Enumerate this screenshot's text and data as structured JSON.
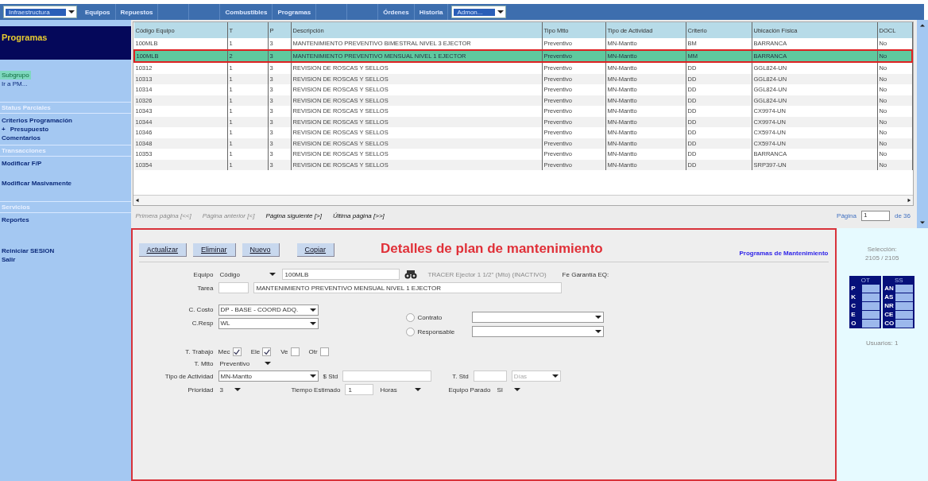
{
  "menu": [
    {
      "kind": "select",
      "label": "Infraestructura"
    },
    {
      "kind": "link",
      "label": "Equipos"
    },
    {
      "kind": "link",
      "label": "Repuestos"
    },
    {
      "kind": "gap"
    },
    {
      "kind": "gap"
    },
    {
      "kind": "link",
      "label": "Combustibles"
    },
    {
      "kind": "link",
      "label": "Programas"
    },
    {
      "kind": "gap"
    },
    {
      "kind": "gap"
    },
    {
      "kind": "link",
      "label": "Órdenes"
    },
    {
      "kind": "link",
      "label": "Historia"
    },
    {
      "kind": "select",
      "label": "Admon..."
    }
  ],
  "sidebar": [
    {
      "kind": "title",
      "label": "Programas"
    },
    {
      "kind": "space"
    },
    {
      "kind": "item",
      "label": "Subgrupo",
      "selected": true
    },
    {
      "kind": "item",
      "label": "Ir a PM...",
      "selected": false
    },
    {
      "kind": "space"
    },
    {
      "kind": "header",
      "label": "Status Parciales"
    },
    {
      "kind": "bold",
      "label": "Criterios Programación",
      "selected": false
    },
    {
      "kind": "tree",
      "label": "Presupuesto",
      "sign": "+",
      "selected": false
    },
    {
      "kind": "bold",
      "label": "Comentarios",
      "selected": false
    },
    {
      "kind": "header",
      "label": "Transacciones"
    },
    {
      "kind": "bold",
      "label": "Modificar F/P",
      "selected": false
    },
    {
      "kind": "space"
    },
    {
      "kind": "bold",
      "label": "Modificar Masivamente",
      "selected": false
    },
    {
      "kind": "space"
    },
    {
      "kind": "header",
      "label": "Servicios"
    },
    {
      "kind": "bold",
      "label": "Reportes",
      "selected": false
    },
    {
      "kind": "space"
    },
    {
      "kind": "space"
    },
    {
      "kind": "bold",
      "label": "Reiniciar SESION",
      "selected": false
    },
    {
      "kind": "bold",
      "label": "Salir",
      "selected": false
    }
  ],
  "table": {
    "columns": [
      "Código Equipo",
      "T",
      "P",
      "Descripción",
      "Tipo Mtto",
      "Tipo de Actividad",
      "Criterio",
      "Ubicación Física",
      "DOCL"
    ],
    "rows": [
      {
        "selected": false,
        "cells": [
          "100MLB",
          "1",
          "3",
          "MANTENIMIENTO PREVENTIVO BIMESTRAL NIVEL 3 EJECTOR",
          "Preventivo",
          "MN-Mantto",
          "BM",
          "BARRANCA",
          "No"
        ]
      },
      {
        "selected": true,
        "cells": [
          "100MLB",
          "2",
          "3",
          "MANTENIMIENTO PREVENTIVO MENSUAL NIVEL 1 EJECTOR",
          "Preventivo",
          "MN-Mantto",
          "MM",
          "BARRANCA",
          "No"
        ]
      },
      {
        "selected": false,
        "cells": [
          "10312",
          "1",
          "3",
          "REVISION DE ROSCAS Y SELLOS",
          "Preventivo",
          "MN-Mantto",
          "DD",
          "GGL824-UN",
          "No"
        ]
      },
      {
        "selected": false,
        "cells": [
          "10313",
          "1",
          "3",
          "REVISION DE ROSCAS Y SELLOS",
          "Preventivo",
          "MN-Mantto",
          "DD",
          "GGL824-UN",
          "No"
        ]
      },
      {
        "selected": false,
        "cells": [
          "10314",
          "1",
          "3",
          "REVISION DE ROSCAS Y SELLOS",
          "Preventivo",
          "MN-Mantto",
          "DD",
          "GGL824-UN",
          "No"
        ]
      },
      {
        "selected": false,
        "cells": [
          "10326",
          "1",
          "3",
          "REVISION DE ROSCAS Y SELLOS",
          "Preventivo",
          "MN-Mantto",
          "DD",
          "GGL824-UN",
          "No"
        ]
      },
      {
        "selected": false,
        "cells": [
          "10343",
          "1",
          "3",
          "REVISION DE ROSCAS Y SELLOS",
          "Preventivo",
          "MN-Mantto",
          "DD",
          "CX9974-UN",
          "No"
        ]
      },
      {
        "selected": false,
        "cells": [
          "10344",
          "1",
          "3",
          "REVISION DE ROSCAS Y SELLOS",
          "Preventivo",
          "MN-Mantto",
          "DD",
          "CX9974-UN",
          "No"
        ]
      },
      {
        "selected": false,
        "cells": [
          "10346",
          "1",
          "3",
          "REVISION DE ROSCAS Y SELLOS",
          "Preventivo",
          "MN-Mantto",
          "DD",
          "CX5974-UN",
          "No"
        ]
      },
      {
        "selected": false,
        "cells": [
          "10348",
          "1",
          "3",
          "REVISION DE ROSCAS Y SELLOS",
          "Preventivo",
          "MN-Mantto",
          "DD",
          "CX5974-UN",
          "No"
        ]
      },
      {
        "selected": false,
        "cells": [
          "10353",
          "1",
          "3",
          "REVISION DE ROSCAS Y SELLOS",
          "Preventivo",
          "MN-Mantto",
          "DD",
          "BARRANCA",
          "No"
        ]
      },
      {
        "selected": false,
        "cells": [
          "10354",
          "1",
          "3",
          "REVISION DE ROSCAS Y SELLOS",
          "Preventivo",
          "MN-Mantto",
          "DD",
          "SRP397-UN",
          "No"
        ]
      }
    ]
  },
  "pager": {
    "links": [
      {
        "label": "Primera página [<<]",
        "disabled": true
      },
      {
        "label": "Página anterior [<]",
        "disabled": true
      },
      {
        "label": "Página siguiente [>]",
        "disabled": false
      },
      {
        "label": "Última página [>>]",
        "disabled": false
      }
    ],
    "page_label": "Página",
    "page": "1",
    "total": "de 36"
  },
  "details": {
    "title": "Detalles de plan de mantenimiento",
    "link": "Programas de Mantenimiento",
    "buttons": [
      "Actualizar",
      "Eliminar",
      "Nuevo",
      "Copiar"
    ],
    "equipo": {
      "label": "Equipo",
      "mode": "Código",
      "value": "100MLB",
      "info": "TRACER Ejector 1 1/2\" (Mto) (INACTIVO)",
      "warranty": "Fe Garantía EQ:"
    },
    "tarea": {
      "label": "Tarea",
      "value": "MANTENIMIENTO PREVENTIVO MENSUAL NIVEL 1 EJECTOR"
    },
    "costo": {
      "label": "C. Costo",
      "value": "DP - BASE - COORD ADQ."
    },
    "resp": {
      "label": "C.Resp",
      "value": "WL"
    },
    "radios": [
      {
        "label": "Contrato",
        "selected": false
      },
      {
        "label": "Responsable",
        "selected": false
      }
    ],
    "trabajo": {
      "label": "T. Trabajo",
      "options": [
        {
          "label": "Mec",
          "checked": true
        },
        {
          "label": "Ele",
          "checked": true
        },
        {
          "label": "Ve",
          "checked": false
        },
        {
          "label": "Otr",
          "checked": false
        }
      ]
    },
    "mtto": {
      "label": "T. Mtto",
      "value": "Preventivo"
    },
    "actividad": {
      "label": "Tipo de Actividad",
      "value": "MN-Mantto"
    },
    "std_cost": {
      "label": "$ Std"
    },
    "std_time": {
      "label": "T. Std",
      "unit": "Días"
    },
    "prioridad": {
      "label": "Prioridad",
      "value": "3"
    },
    "tiempo": {
      "label": "Tiempo Estimado",
      "value": "1",
      "unit": "Horas"
    },
    "parado": {
      "label": "Equipo Parado",
      "value": "SI"
    }
  },
  "side": {
    "selection_label": "Selección:",
    "selection": "2105 / 2105",
    "groups": [
      {
        "title": "OT",
        "rows": [
          "P",
          "K",
          "C",
          "E",
          "O"
        ]
      },
      {
        "title": "SS",
        "rows": [
          "AN",
          "AS",
          "NR",
          "CE",
          "CO"
        ]
      }
    ],
    "users": "Usuarios: 1"
  }
}
